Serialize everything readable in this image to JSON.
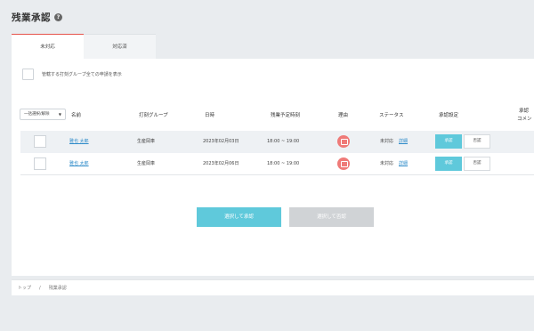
{
  "page": {
    "title": "残業承認"
  },
  "tabs": [
    {
      "label": "未対応"
    },
    {
      "label": "対応済"
    }
  ],
  "filter": {
    "label": "管轄する打刻グループ全ての申請を表示"
  },
  "bulk": {
    "select_value": "一括選択/解除"
  },
  "table": {
    "headers": {
      "name": "名前",
      "group": "打刻グループ",
      "date": "日時",
      "time": "残業予定時刻",
      "reason": "理由",
      "status": "ステータス",
      "action": "承認設定",
      "comment_line1": "承認",
      "comment_line2": "コメン"
    },
    "rows": [
      {
        "name": "雅也 太郎",
        "group": "生産岡車",
        "date": "2023年02月03日",
        "time": "18:00 ~ 19:00",
        "status": "未対応",
        "detail": "詳細",
        "approve": "承認",
        "reject": "否認"
      },
      {
        "name": "雅也 太郎",
        "group": "生産岡車",
        "date": "2023年02月06日",
        "time": "18:00 ~ 19:00",
        "status": "未対応",
        "detail": "詳細",
        "approve": "承認",
        "reject": "否認"
      }
    ]
  },
  "actions": {
    "approve_selected": "選択して承認",
    "reject_selected": "選択して否認"
  },
  "breadcrumb": {
    "home": "トップ",
    "sep": "/",
    "current": "残業承認"
  },
  "colors": {
    "accent": "#5fc9db",
    "active_tab_border": "#e5534b",
    "reason_icon": "#ef7a78",
    "link": "#2e8bc9"
  }
}
